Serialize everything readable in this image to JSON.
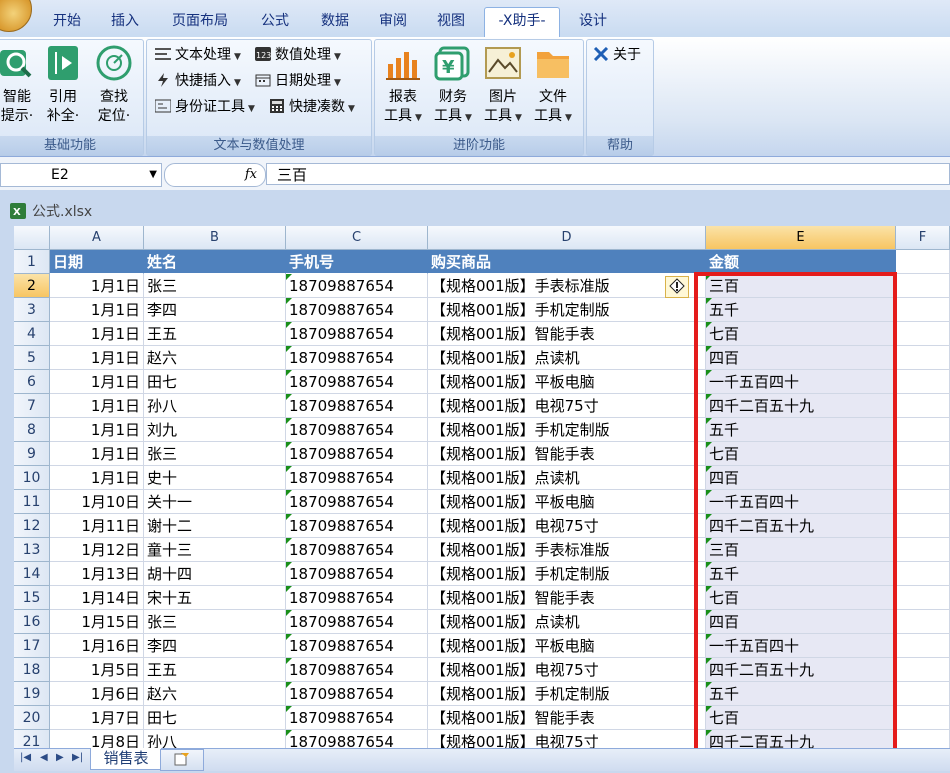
{
  "ribbon": {
    "tabs": [
      "开始",
      "插入",
      "页面布局",
      "公式",
      "数据",
      "审阅",
      "视图",
      "-X助手-",
      "设计"
    ],
    "active_tab": "-X助手-",
    "groups": {
      "basic": {
        "label": "基础功能",
        "buttons": [
          {
            "line1": "智能",
            "line2": "提示·",
            "icon": "search-icon"
          },
          {
            "line1": "引用",
            "line2": "补全·",
            "icon": "reference-icon"
          },
          {
            "line1": "查找",
            "line2": "定位·",
            "icon": "locate-icon"
          }
        ]
      },
      "text_num": {
        "label": "文本与数值处理",
        "items": [
          {
            "label": "文本处理",
            "icon": "text-process-icon"
          },
          {
            "label": "数值处理",
            "icon": "number-process-icon"
          },
          {
            "label": "快捷插入",
            "icon": "quick-insert-icon"
          },
          {
            "label": "日期处理",
            "icon": "date-process-icon"
          },
          {
            "label": "身份证工具",
            "icon": "id-card-icon"
          },
          {
            "label": "快捷凑数",
            "icon": "quick-sum-icon"
          }
        ]
      },
      "advanced": {
        "label": "进阶功能",
        "buttons": [
          {
            "line1": "报表",
            "line2": "工具",
            "icon": "report-chart-icon"
          },
          {
            "line1": "财务",
            "line2": "工具",
            "icon": "finance-icon"
          },
          {
            "line1": "图片",
            "line2": "工具",
            "icon": "picture-icon"
          },
          {
            "line1": "文件",
            "line2": "工具",
            "icon": "folder-icon"
          }
        ]
      },
      "help": {
        "label": "帮助",
        "about": "关于"
      }
    }
  },
  "formula_bar": {
    "name_box": "E2",
    "fx": "fx",
    "value": "三百"
  },
  "workbook": {
    "title": "公式.xlsx",
    "sheet_tab": "销售表"
  },
  "grid": {
    "columns": [
      "A",
      "B",
      "C",
      "D",
      "E",
      "F"
    ],
    "selected_column": "E",
    "header_row": [
      "日期",
      "姓名",
      "手机号",
      "购买商品",
      "金额"
    ],
    "rows": [
      {
        "n": "2",
        "date": "1月1日",
        "name": "张三",
        "phone": "18709887654",
        "product": "【规格001版】手表标准版",
        "amount": "三百"
      },
      {
        "n": "3",
        "date": "1月1日",
        "name": "李四",
        "phone": "18709887654",
        "product": "【规格001版】手机定制版",
        "amount": "五千"
      },
      {
        "n": "4",
        "date": "1月1日",
        "name": "王五",
        "phone": "18709887654",
        "product": "【规格001版】智能手表",
        "amount": "七百"
      },
      {
        "n": "5",
        "date": "1月1日",
        "name": "赵六",
        "phone": "18709887654",
        "product": "【规格001版】点读机",
        "amount": "四百"
      },
      {
        "n": "6",
        "date": "1月1日",
        "name": "田七",
        "phone": "18709887654",
        "product": "【规格001版】平板电脑",
        "amount": "一千五百四十"
      },
      {
        "n": "7",
        "date": "1月1日",
        "name": "孙八",
        "phone": "18709887654",
        "product": "【规格001版】电视75寸",
        "amount": "四千二百五十九"
      },
      {
        "n": "8",
        "date": "1月1日",
        "name": "刘九",
        "phone": "18709887654",
        "product": "【规格001版】手机定制版",
        "amount": "五千"
      },
      {
        "n": "9",
        "date": "1月1日",
        "name": "张三",
        "phone": "18709887654",
        "product": "【规格001版】智能手表",
        "amount": "七百"
      },
      {
        "n": "10",
        "date": "1月1日",
        "name": "史十",
        "phone": "18709887654",
        "product": "【规格001版】点读机",
        "amount": "四百"
      },
      {
        "n": "11",
        "date": "1月10日",
        "name": "关十一",
        "phone": "18709887654",
        "product": "【规格001版】平板电脑",
        "amount": "一千五百四十"
      },
      {
        "n": "12",
        "date": "1月11日",
        "name": "谢十二",
        "phone": "18709887654",
        "product": "【规格001版】电视75寸",
        "amount": "四千二百五十九"
      },
      {
        "n": "13",
        "date": "1月12日",
        "name": "童十三",
        "phone": "18709887654",
        "product": "【规格001版】手表标准版",
        "amount": "三百"
      },
      {
        "n": "14",
        "date": "1月13日",
        "name": "胡十四",
        "phone": "18709887654",
        "product": "【规格001版】手机定制版",
        "amount": "五千"
      },
      {
        "n": "15",
        "date": "1月14日",
        "name": "宋十五",
        "phone": "18709887654",
        "product": "【规格001版】智能手表",
        "amount": "七百"
      },
      {
        "n": "16",
        "date": "1月15日",
        "name": "张三",
        "phone": "18709887654",
        "product": "【规格001版】点读机",
        "amount": "四百"
      },
      {
        "n": "17",
        "date": "1月16日",
        "name": "李四",
        "phone": "18709887654",
        "product": "【规格001版】平板电脑",
        "amount": "一千五百四十"
      },
      {
        "n": "18",
        "date": "1月5日",
        "name": "王五",
        "phone": "18709887654",
        "product": "【规格001版】电视75寸",
        "amount": "四千二百五十九"
      },
      {
        "n": "19",
        "date": "1月6日",
        "name": "赵六",
        "phone": "18709887654",
        "product": "【规格001版】手机定制版",
        "amount": "五千"
      },
      {
        "n": "20",
        "date": "1月7日",
        "name": "田七",
        "phone": "18709887654",
        "product": "【规格001版】智能手表",
        "amount": "七百"
      },
      {
        "n": "21",
        "date": "1月8日",
        "name": "孙八",
        "phone": "18709887654",
        "product": "【规格001版】电视75寸",
        "amount": "四千二百五十九"
      }
    ]
  },
  "colors": {
    "header_fill": "#4f81bd",
    "highlight_box": "#e41b1b",
    "amount_fill": "#e7e8f4"
  }
}
